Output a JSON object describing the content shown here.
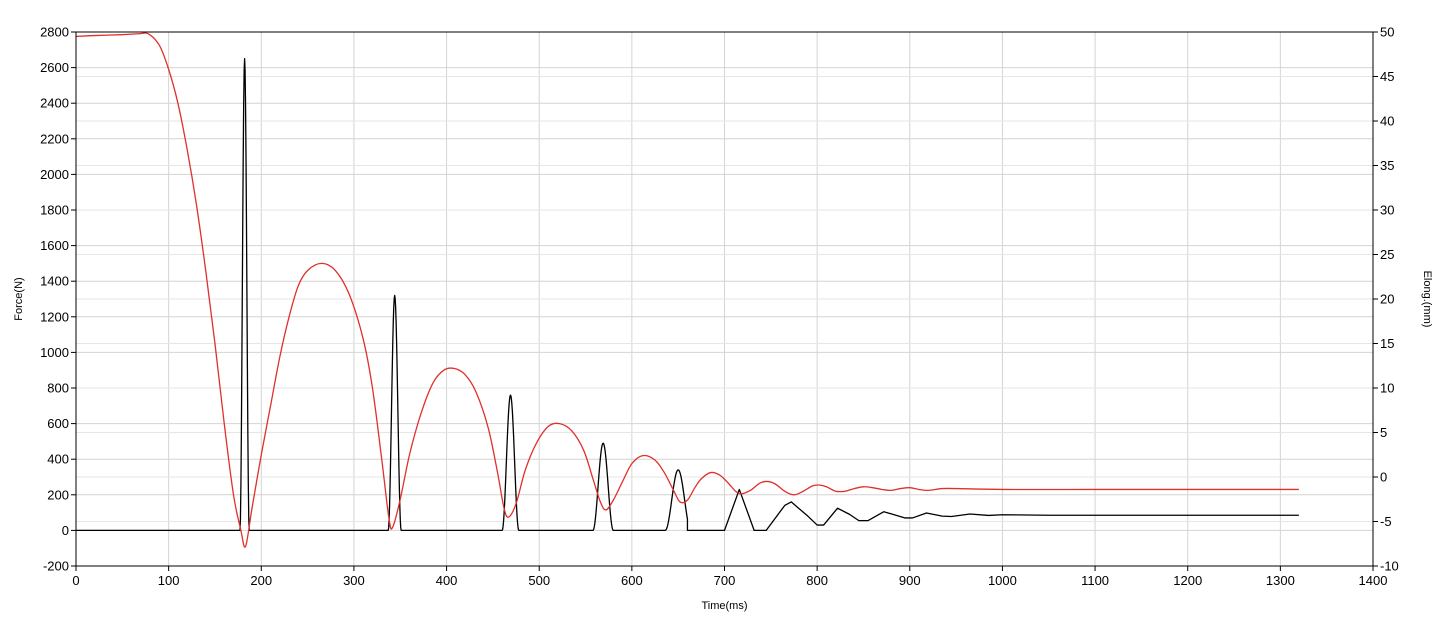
{
  "chart_data": {
    "type": "line",
    "xlabel": "Time(ms)",
    "ylabel_left": "Force(N)",
    "ylabel_right": "Elong.(mm)",
    "xlim": [
      0,
      1400
    ],
    "ylim_left": [
      -200,
      2800
    ],
    "ylim_right": [
      -10,
      50
    ],
    "grid": true,
    "x_ticks": [
      0,
      100,
      200,
      300,
      400,
      500,
      600,
      700,
      800,
      900,
      1000,
      1100,
      1200,
      1300,
      1400
    ],
    "y_left_ticks": [
      -200,
      0,
      200,
      400,
      600,
      800,
      1000,
      1200,
      1400,
      1600,
      1800,
      2000,
      2200,
      2400,
      2600,
      2800
    ],
    "y_right_ticks": [
      -10,
      -5,
      0,
      5,
      10,
      15,
      20,
      25,
      30,
      35,
      40,
      45,
      50
    ],
    "series": [
      {
        "axis": "left",
        "color": "#000000",
        "baseline": 0,
        "pulses": [
          {
            "center": 182,
            "halfwidth": 5,
            "peak": 2650
          },
          {
            "center": 344,
            "halfwidth": 7,
            "peak": 1320
          },
          {
            "center": 469,
            "halfwidth": 9,
            "peak": 760
          },
          {
            "center": 569,
            "halfwidth": 11,
            "peak": 490
          },
          {
            "center": 650,
            "halfwidth": 14,
            "peak": 340
          }
        ],
        "tail": [
          [
            660,
            0
          ],
          [
            672,
            0
          ],
          [
            700,
            0
          ],
          [
            716,
            230
          ],
          [
            732,
            0
          ],
          [
            745,
            0
          ],
          [
            765,
            140
          ],
          [
            772,
            160
          ],
          [
            790,
            80
          ],
          [
            800,
            30
          ],
          [
            807,
            30
          ],
          [
            822,
            125
          ],
          [
            835,
            90
          ],
          [
            845,
            55
          ],
          [
            855,
            55
          ],
          [
            872,
            105
          ],
          [
            885,
            85
          ],
          [
            895,
            70
          ],
          [
            903,
            70
          ],
          [
            918,
            98
          ],
          [
            935,
            80
          ],
          [
            945,
            78
          ],
          [
            965,
            92
          ],
          [
            985,
            84
          ],
          [
            1000,
            88
          ],
          [
            1050,
            85
          ],
          [
            1100,
            85
          ],
          [
            1320,
            85
          ]
        ]
      },
      {
        "axis": "right",
        "color": "#e0302b",
        "points": [
          [
            0,
            49.5
          ],
          [
            20,
            49.6
          ],
          [
            50,
            49.7
          ],
          [
            68,
            49.8
          ],
          [
            78,
            49.8
          ],
          [
            90,
            48.5
          ],
          [
            100,
            45.8
          ],
          [
            110,
            42.0
          ],
          [
            120,
            36.8
          ],
          [
            130,
            30.6
          ],
          [
            140,
            23.2
          ],
          [
            150,
            15.0
          ],
          [
            160,
            6.0
          ],
          [
            170,
            -2.0
          ],
          [
            178,
            -6.0
          ],
          [
            183,
            -7.8
          ],
          [
            190,
            -3.5
          ],
          [
            200,
            2.5
          ],
          [
            210,
            8.0
          ],
          [
            220,
            13.5
          ],
          [
            230,
            18.0
          ],
          [
            240,
            21.5
          ],
          [
            250,
            23.2
          ],
          [
            265,
            24.0
          ],
          [
            280,
            23.2
          ],
          [
            295,
            20.5
          ],
          [
            310,
            15.5
          ],
          [
            320,
            10.0
          ],
          [
            330,
            2.0
          ],
          [
            338,
            -4.8
          ],
          [
            342,
            -5.6
          ],
          [
            350,
            -2.5
          ],
          [
            360,
            2.5
          ],
          [
            372,
            7.0
          ],
          [
            385,
            10.5
          ],
          [
            397,
            12.0
          ],
          [
            408,
            12.2
          ],
          [
            420,
            11.5
          ],
          [
            432,
            9.5
          ],
          [
            445,
            5.5
          ],
          [
            455,
            0.5
          ],
          [
            462,
            -3.5
          ],
          [
            467,
            -4.5
          ],
          [
            475,
            -3.0
          ],
          [
            485,
            0.8
          ],
          [
            497,
            3.8
          ],
          [
            510,
            5.7
          ],
          [
            522,
            6.0
          ],
          [
            535,
            5.2
          ],
          [
            548,
            3.0
          ],
          [
            558,
            -0.2
          ],
          [
            566,
            -2.8
          ],
          [
            572,
            -3.7
          ],
          [
            580,
            -2.6
          ],
          [
            590,
            -0.5
          ],
          [
            600,
            1.5
          ],
          [
            612,
            2.4
          ],
          [
            625,
            1.9
          ],
          [
            635,
            0.5
          ],
          [
            645,
            -1.5
          ],
          [
            652,
            -2.8
          ],
          [
            660,
            -2.6
          ],
          [
            668,
            -1.2
          ],
          [
            675,
            -0.2
          ],
          [
            685,
            0.5
          ],
          [
            695,
            0.2
          ],
          [
            705,
            -0.8
          ],
          [
            712,
            -1.6
          ],
          [
            718,
            -1.9
          ],
          [
            728,
            -1.5
          ],
          [
            738,
            -0.7
          ],
          [
            746,
            -0.5
          ],
          [
            755,
            -0.8
          ],
          [
            765,
            -1.6
          ],
          [
            775,
            -2.0
          ],
          [
            785,
            -1.6
          ],
          [
            795,
            -1.0
          ],
          [
            802,
            -0.9
          ],
          [
            810,
            -1.1
          ],
          [
            820,
            -1.6
          ],
          [
            830,
            -1.6
          ],
          [
            840,
            -1.3
          ],
          [
            850,
            -1.1
          ],
          [
            860,
            -1.2
          ],
          [
            870,
            -1.4
          ],
          [
            880,
            -1.5
          ],
          [
            890,
            -1.3
          ],
          [
            900,
            -1.2
          ],
          [
            910,
            -1.4
          ],
          [
            920,
            -1.5
          ],
          [
            935,
            -1.3
          ],
          [
            950,
            -1.3
          ],
          [
            1000,
            -1.4
          ],
          [
            1100,
            -1.4
          ],
          [
            1200,
            -1.4
          ],
          [
            1320,
            -1.4
          ]
        ]
      }
    ]
  }
}
